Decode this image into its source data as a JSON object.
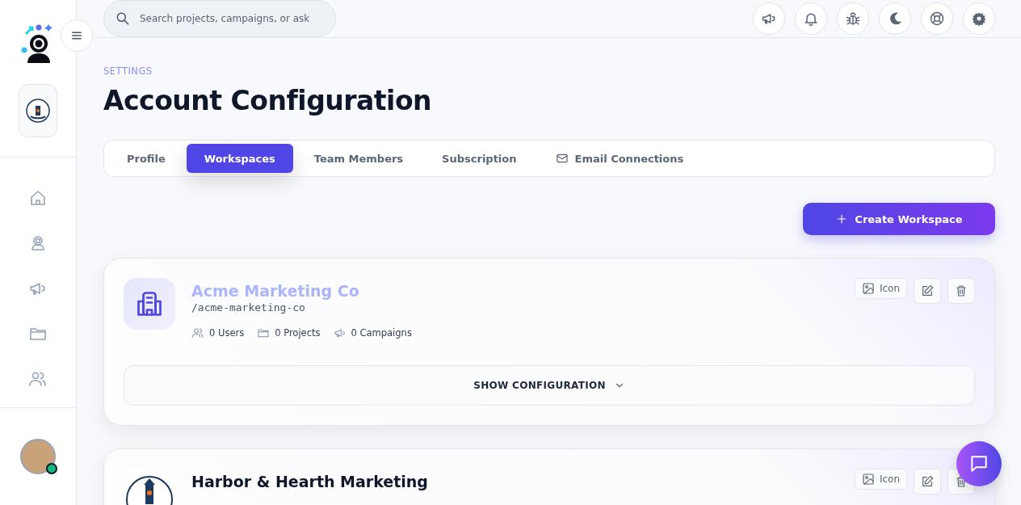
{
  "sidebar": {
    "user": {
      "online": true
    }
  },
  "topbar": {
    "search": {
      "placeholder": "Search projects, campaigns, or ask"
    }
  },
  "page": {
    "eyebrow": "SETTINGS",
    "title": "Account Configuration"
  },
  "tabs": [
    {
      "label": "Profile",
      "selected": false
    },
    {
      "label": "Workspaces",
      "selected": true
    },
    {
      "label": "Team Members",
      "selected": false
    },
    {
      "label": "Subscription",
      "selected": false
    },
    {
      "label": "Email Connections",
      "selected": false
    }
  ],
  "create_button": {
    "label": "Create Workspace"
  },
  "workspaces": [
    {
      "kind": "default",
      "name": "Acme Marketing Co",
      "dimmed": true,
      "slug": "/acme-marketing-co",
      "stats": [
        "0 Users",
        "0 Projects",
        "0 Campaigns"
      ],
      "icon_button": "Icon",
      "config_toggle": "SHOW CONFIGURATION"
    },
    {
      "kind": "logo",
      "name": "Harbor & Hearth Marketing",
      "dimmed": false,
      "icon_button": "Icon"
    }
  ]
}
